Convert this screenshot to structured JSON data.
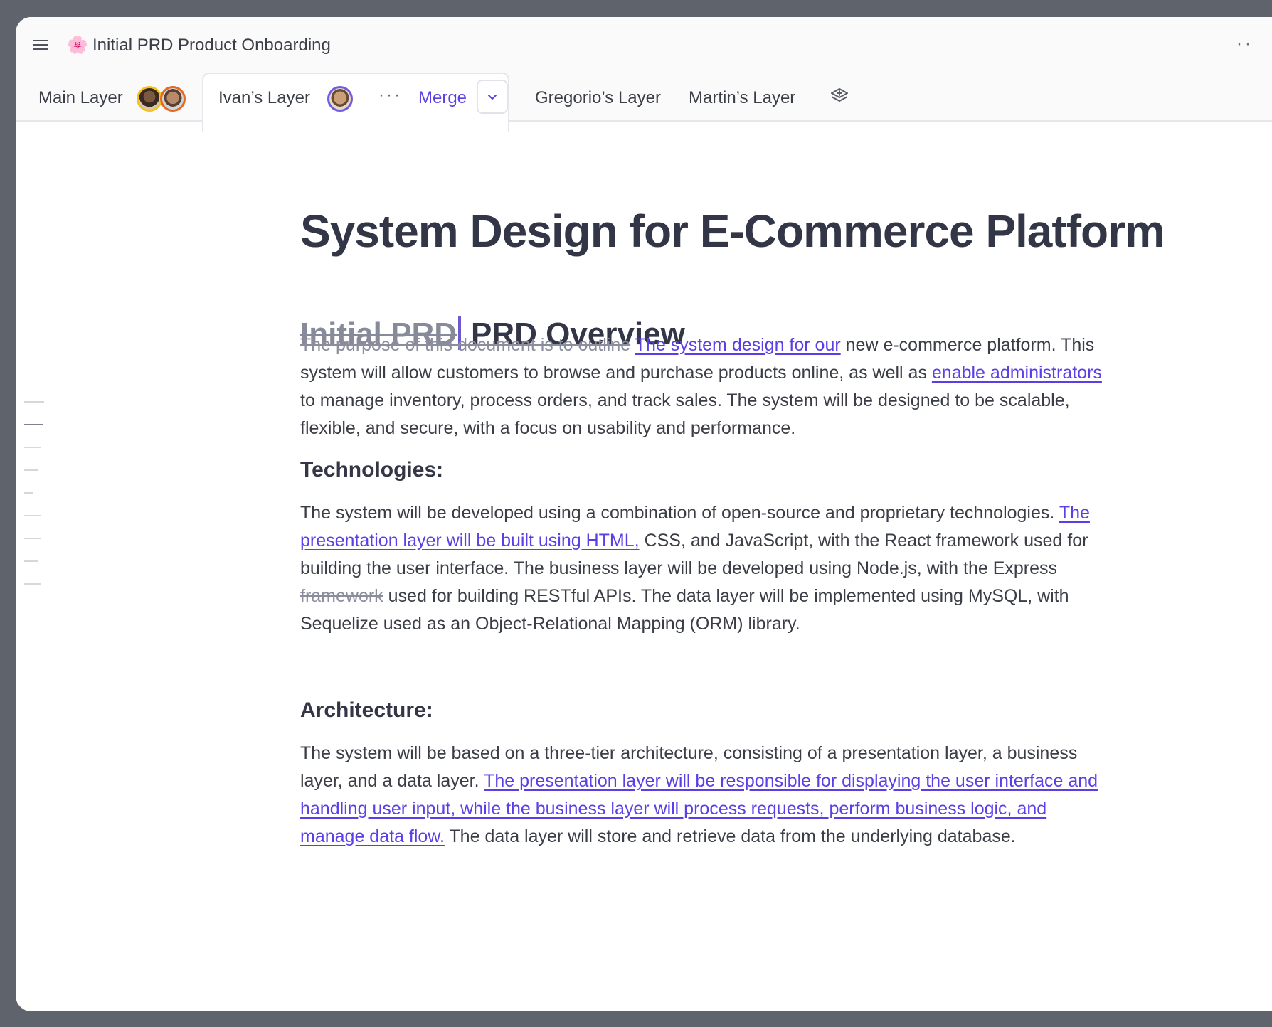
{
  "header": {
    "doc_emoji": "🌸",
    "doc_title": "Initial PRD Product Onboarding"
  },
  "tabs": {
    "main": "Main Layer",
    "ivan": "Ivan’s Layer",
    "more": "···",
    "merge": "Merge",
    "gregorio": "Gregorio’s Layer",
    "martin": "Martin’s Layer"
  },
  "doc": {
    "title": "System Design for E-Commerce Platform",
    "overview_deleted": "Initial PRD",
    "overview_heading": "PRD Overview",
    "p1": {
      "del1": "The purpose of this document is to outline",
      "ins1": "The system design for our",
      "t1": " new e-commerce platform. This system will allow customers to browse and purchase products online, as well as ",
      "ins2": "enable administrators",
      "t2": " to manage inventory, process orders, and track sales. The system will be designed to be scalable, flexible, and secure, with a focus on usability and performance."
    },
    "tech_heading": "Technologies:",
    "p2": {
      "t1": "The system will be developed using a combination of open-source and proprietary technologies. ",
      "ins1": "The presentation layer will be built using HTML,",
      "t2": " CSS, and JavaScript, with the React framework used for building the user interface. The business layer will be developed using Node.js, with the Express ",
      "del1": "framework",
      "t3": " used for building RESTful APIs. The data layer will be implemented using MySQL, with Sequelize used as an Object-Relational Mapping (ORM) library."
    },
    "arch_heading": "Architecture:",
    "p3": {
      "t1": "The system will be based on a three-tier architecture, consisting of a presentation layer, a business layer, and a data layer. ",
      "ins1": "The presentation layer will be responsible for displaying the user interface and handling user input, while the business layer will process requests, perform business logic, and manage data flow.",
      "t2": " The data layer will store and retrieve data from the underlying database."
    }
  },
  "colors": {
    "accent": "#5b3fe6",
    "deleted": "#8a8e9c",
    "text": "#3b3e47",
    "frame": "#5f636c"
  },
  "icons": [
    "hamburger-menu-icon",
    "more-dots-icon",
    "chevron-down-icon",
    "layers-icon"
  ]
}
